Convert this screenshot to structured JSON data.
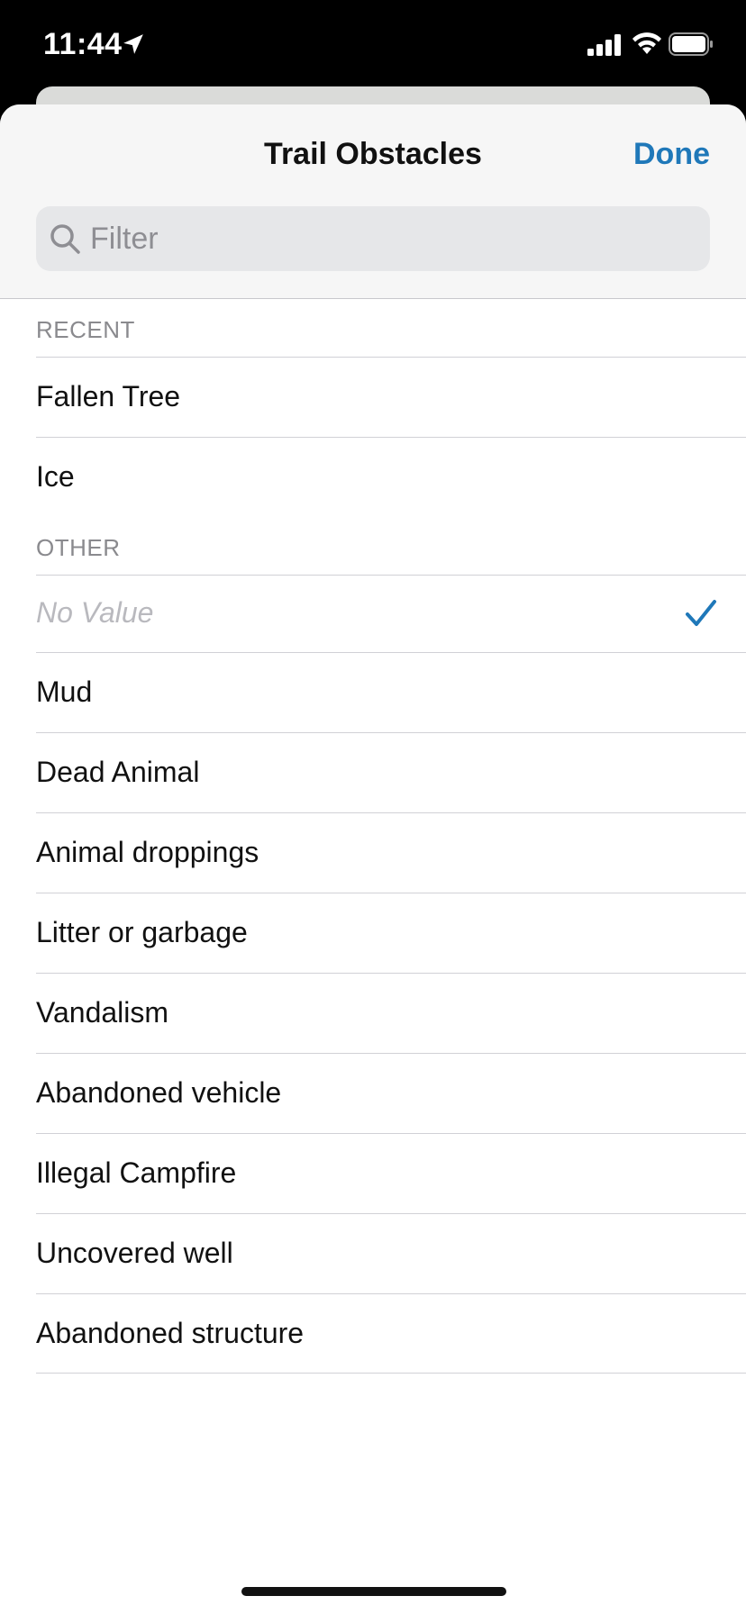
{
  "status": {
    "time": "11:44"
  },
  "header": {
    "title": "Trail Obstacles",
    "done_label": "Done"
  },
  "filter": {
    "placeholder": "Filter",
    "value": ""
  },
  "sections": {
    "recent": {
      "title": "RECENT",
      "items": [
        "Fallen Tree",
        "Ice"
      ]
    },
    "other": {
      "title": "OTHER",
      "no_value_label": "No Value",
      "no_value_selected": true,
      "items": [
        "Mud",
        "Dead Animal",
        "Animal droppings",
        "Litter or garbage",
        "Vandalism",
        "Abandoned vehicle",
        "Illegal Campfire",
        "Uncovered well",
        "Abandoned structure"
      ]
    }
  },
  "colors": {
    "accent": "#1f78b9",
    "header_bg": "#f6f6f6",
    "filter_bg": "#e6e7e9"
  }
}
